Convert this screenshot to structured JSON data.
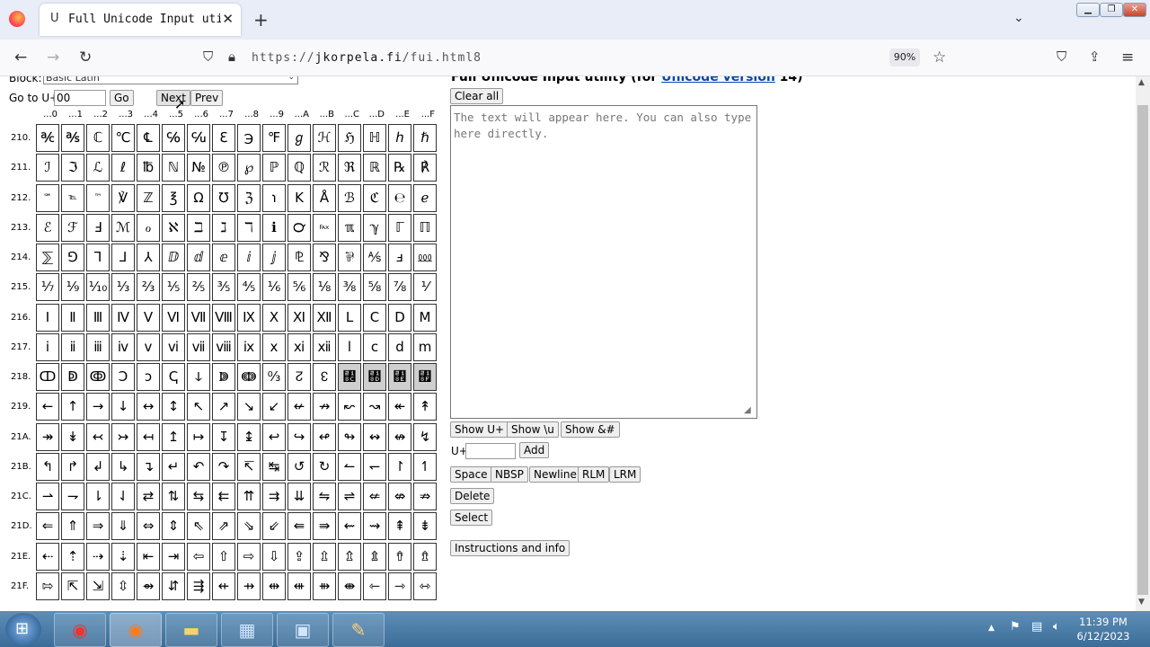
{
  "browser": {
    "tab_title": "Full Unicode Input utility",
    "tab_icon": "U",
    "url_prefix": "https://",
    "url_domain": "jkorpela.fi",
    "url_path": "/fui.html8",
    "zoom": "90%"
  },
  "controls": {
    "block_label": "Block:",
    "block_value": "Basic Latin",
    "goto_label": "Go to U+",
    "goto_value": "00",
    "go": "Go",
    "next": "Next",
    "prev": "Prev"
  },
  "grid": {
    "col_headers": [
      "...0",
      "...1",
      "...2",
      "...3",
      "...4",
      "...5",
      "...6",
      "...7",
      "...8",
      "...9",
      "...A",
      "...B",
      "...C",
      "...D",
      "...E",
      "...F"
    ],
    "rows": [
      {
        "label": "210.",
        "cells": [
          "℀",
          "℁",
          "ℂ",
          "℃",
          "℄",
          "℅",
          "℆",
          "ℇ",
          "℈",
          "℉",
          "ℊ",
          "ℋ",
          "ℌ",
          "ℍ",
          "ℎ",
          "ℏ"
        ]
      },
      {
        "label": "211.",
        "cells": [
          "ℐ",
          "ℑ",
          "ℒ",
          "ℓ",
          "℔",
          "ℕ",
          "№",
          "℗",
          "℘",
          "ℙ",
          "ℚ",
          "ℛ",
          "ℜ",
          "ℝ",
          "℞",
          "℟"
        ]
      },
      {
        "label": "212.",
        "cells": [
          "℠",
          "℡",
          "™",
          "℣",
          "ℤ",
          "℥",
          "Ω",
          "℧",
          "ℨ",
          "℩",
          "K",
          "Å",
          "ℬ",
          "ℭ",
          "℮",
          "ℯ"
        ]
      },
      {
        "label": "213.",
        "cells": [
          "ℰ",
          "ℱ",
          "Ⅎ",
          "ℳ",
          "ℴ",
          "ℵ",
          "ℶ",
          "ℷ",
          "ℸ",
          "ℹ",
          "℺",
          "℻",
          "ℼ",
          "ℽ",
          "ℾ",
          "ℿ"
        ]
      },
      {
        "label": "214.",
        "cells": [
          "⅀",
          "⅁",
          "⅂",
          "⅃",
          "⅄",
          "ⅅ",
          "ⅆ",
          "ⅇ",
          "ⅈ",
          "ⅉ",
          "⅊",
          "⅋",
          "⅌",
          "⅍",
          "ⅎ",
          "⅏"
        ]
      },
      {
        "label": "215.",
        "cells": [
          "⅐",
          "⅑",
          "⅒",
          "⅓",
          "⅔",
          "⅕",
          "⅖",
          "⅗",
          "⅘",
          "⅙",
          "⅚",
          "⅛",
          "⅜",
          "⅝",
          "⅞",
          "⅟"
        ]
      },
      {
        "label": "216.",
        "cells": [
          "Ⅰ",
          "Ⅱ",
          "Ⅲ",
          "Ⅳ",
          "Ⅴ",
          "Ⅵ",
          "Ⅶ",
          "Ⅷ",
          "Ⅸ",
          "Ⅹ",
          "Ⅺ",
          "Ⅻ",
          "Ⅼ",
          "Ⅽ",
          "Ⅾ",
          "Ⅿ"
        ]
      },
      {
        "label": "217.",
        "cells": [
          "ⅰ",
          "ⅱ",
          "ⅲ",
          "ⅳ",
          "ⅴ",
          "ⅵ",
          "ⅶ",
          "ⅷ",
          "ⅸ",
          "ⅹ",
          "ⅺ",
          "ⅻ",
          "ⅼ",
          "ⅽ",
          "ⅾ",
          "ⅿ"
        ]
      },
      {
        "label": "218.",
        "cells": [
          "ↀ",
          "ↁ",
          "ↂ",
          "Ↄ",
          "ↄ",
          "ↅ",
          "ↆ",
          "ↇ",
          "ↈ",
          "↉",
          "↊",
          "↋",
          "↌",
          "↍",
          "↎",
          "↏"
        ]
      },
      {
        "label": "219.",
        "cells": [
          "←",
          "↑",
          "→",
          "↓",
          "↔",
          "↕",
          "↖",
          "↗",
          "↘",
          "↙",
          "↚",
          "↛",
          "↜",
          "↝",
          "↞",
          "↟"
        ]
      },
      {
        "label": "21A.",
        "cells": [
          "↠",
          "↡",
          "↢",
          "↣",
          "↤",
          "↥",
          "↦",
          "↧",
          "↨",
          "↩",
          "↪",
          "↫",
          "↬",
          "↭",
          "↮",
          "↯"
        ]
      },
      {
        "label": "21B.",
        "cells": [
          "↰",
          "↱",
          "↲",
          "↳",
          "↴",
          "↵",
          "↶",
          "↷",
          "↸",
          "↹",
          "↺",
          "↻",
          "↼",
          "↽",
          "↾",
          "↿"
        ]
      },
      {
        "label": "21C.",
        "cells": [
          "⇀",
          "⇁",
          "⇂",
          "⇃",
          "⇄",
          "⇅",
          "⇆",
          "⇇",
          "⇈",
          "⇉",
          "⇊",
          "⇋",
          "⇌",
          "⇍",
          "⇎",
          "⇏"
        ]
      },
      {
        "label": "21D.",
        "cells": [
          "⇐",
          "⇑",
          "⇒",
          "⇓",
          "⇔",
          "⇕",
          "⇖",
          "⇗",
          "⇘",
          "⇙",
          "⇚",
          "⇛",
          "⇜",
          "⇝",
          "⇞",
          "⇟"
        ]
      },
      {
        "label": "21E.",
        "cells": [
          "⇠",
          "⇡",
          "⇢",
          "⇣",
          "⇤",
          "⇥",
          "⇦",
          "⇧",
          "⇨",
          "⇩",
          "⇪",
          "⇫",
          "⇬",
          "⇭",
          "⇮",
          "⇯"
        ]
      },
      {
        "label": "21F.",
        "cells": [
          "⇰",
          "⇱",
          "⇲",
          "⇳",
          "⇴",
          "⇵",
          "⇶",
          "⇷",
          "⇸",
          "⇹",
          "⇺",
          "⇻",
          "⇼",
          "⇽",
          "⇾",
          "⇿"
        ]
      }
    ]
  },
  "right": {
    "title_pre": "Full Unicode Input utility (for ",
    "title_link": "Unicode version",
    "title_post": " 14)",
    "clear_all": "Clear all",
    "textarea_placeholder": "The text will appear here. You can also type here directly.",
    "show_u": "Show U+",
    "show_backslash_u": "Show \\u",
    "show_amp": "Show &#",
    "u_label": "U+",
    "add": "Add",
    "space": "Space",
    "nbsp": "NBSP",
    "newline": "Newline",
    "rlm": "RLM",
    "lrm": "LRM",
    "delete": "Delete",
    "select": "Select",
    "instructions": "Instructions and info"
  },
  "taskbar": {
    "time": "11:39 PM",
    "date": "6/12/2023"
  }
}
